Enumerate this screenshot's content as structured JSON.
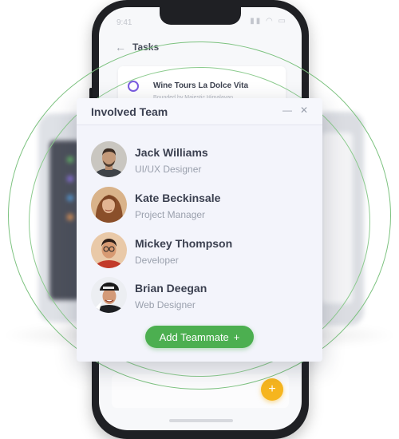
{
  "phone": {
    "status_time": "9:41",
    "status_icons": "▮▮ ◠ ▭",
    "header_title": "Tasks",
    "back_icon": "←",
    "task": {
      "title": "Wine Tours La Dolce Vita",
      "subtitle": "Bounded by Majestic Himalayan"
    },
    "fab_icon": "+"
  },
  "modal": {
    "title": "Involved Team",
    "minimize_icon": "—",
    "close_icon": "✕",
    "members": [
      {
        "name": "Jack Williams",
        "role": "UI/UX Designer"
      },
      {
        "name": "Kate Beckinsale",
        "role": "Project Manager"
      },
      {
        "name": "Mickey Thompson",
        "role": "Developer"
      },
      {
        "name": "Brian Deegan",
        "role": "Web Designer"
      }
    ],
    "add_button": {
      "label": "Add Teammate",
      "icon": "+"
    }
  },
  "colors": {
    "accent_green": "#4caf50",
    "ring_green": "#7cc27f",
    "fab_yellow": "#f6b51e",
    "radio_purple": "#7a5ce0"
  }
}
